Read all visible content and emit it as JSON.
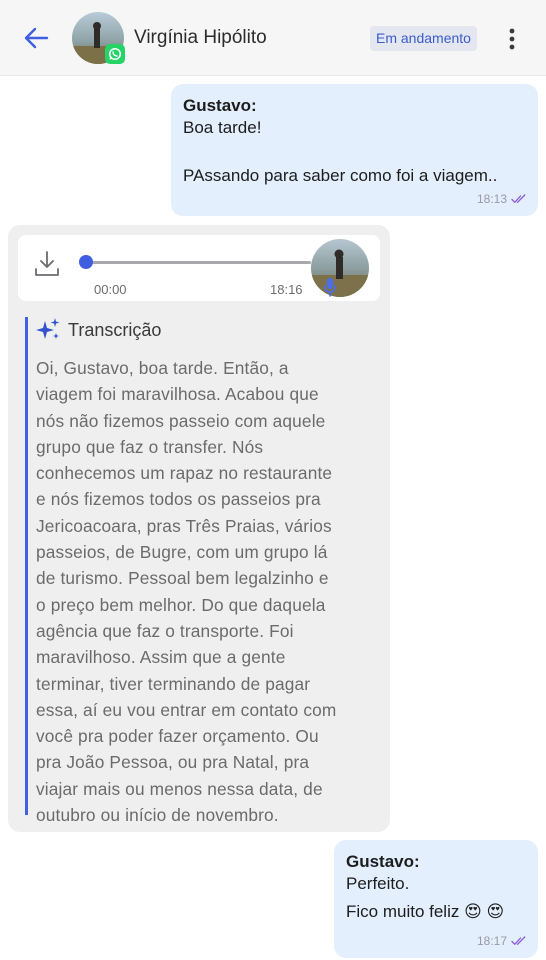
{
  "header": {
    "contact_name": "Virgínia Hipólito",
    "status": "Em andamento",
    "colors": {
      "accent": "#3f5fe0",
      "status_bg": "#e4e7ef",
      "whatsapp": "#25d366"
    }
  },
  "messages": [
    {
      "direction": "outgoing",
      "sender": "Gustavo:",
      "lines": [
        "Boa tarde!",
        "",
        "PAssando para saber como foi a viagem.."
      ],
      "time": "18:13"
    },
    {
      "direction": "incoming",
      "type": "audio",
      "audio": {
        "elapsed": "00:00",
        "time": "18:16",
        "progress": 0
      },
      "transcript_title": "Transcrição",
      "transcript_lines": [
        "Oi, Gustavo, boa tarde. Então, a",
        "viagem foi maravilhosa. Acabou que",
        "nós não fizemos passeio com aquele",
        "grupo que faz o transfer. Nós",
        "conhecemos um rapaz no restaurante",
        "e nós fizemos todos os passeios pra",
        "Jericoacoara, pras Três Praias, vários",
        "passeios, de Bugre, com um grupo lá",
        "de turismo. Pessoal bem legalzinho e",
        "o preço bem melhor. Do que daquela",
        "agência que faz o transporte. Foi",
        "maravilhoso. Assim que a gente",
        "terminar, tiver terminando de pagar",
        "essa, aí eu vou entrar em contato com",
        "você pra poder fazer orçamento. Ou",
        "pra João Pessoa, ou pra Natal, pra",
        "viajar mais ou menos nessa data, de",
        "outubro ou início de novembro."
      ]
    },
    {
      "direction": "outgoing",
      "sender": "Gustavo:",
      "line1": "Perfeito.",
      "line2": "Fico muito feliz 😍  😍",
      "time": "18:17"
    }
  ],
  "icons": [
    "back-arrow-icon",
    "whatsapp-icon",
    "more-vertical-icon",
    "download-icon",
    "microphone-icon",
    "sparkle-icon",
    "double-check-icon"
  ]
}
